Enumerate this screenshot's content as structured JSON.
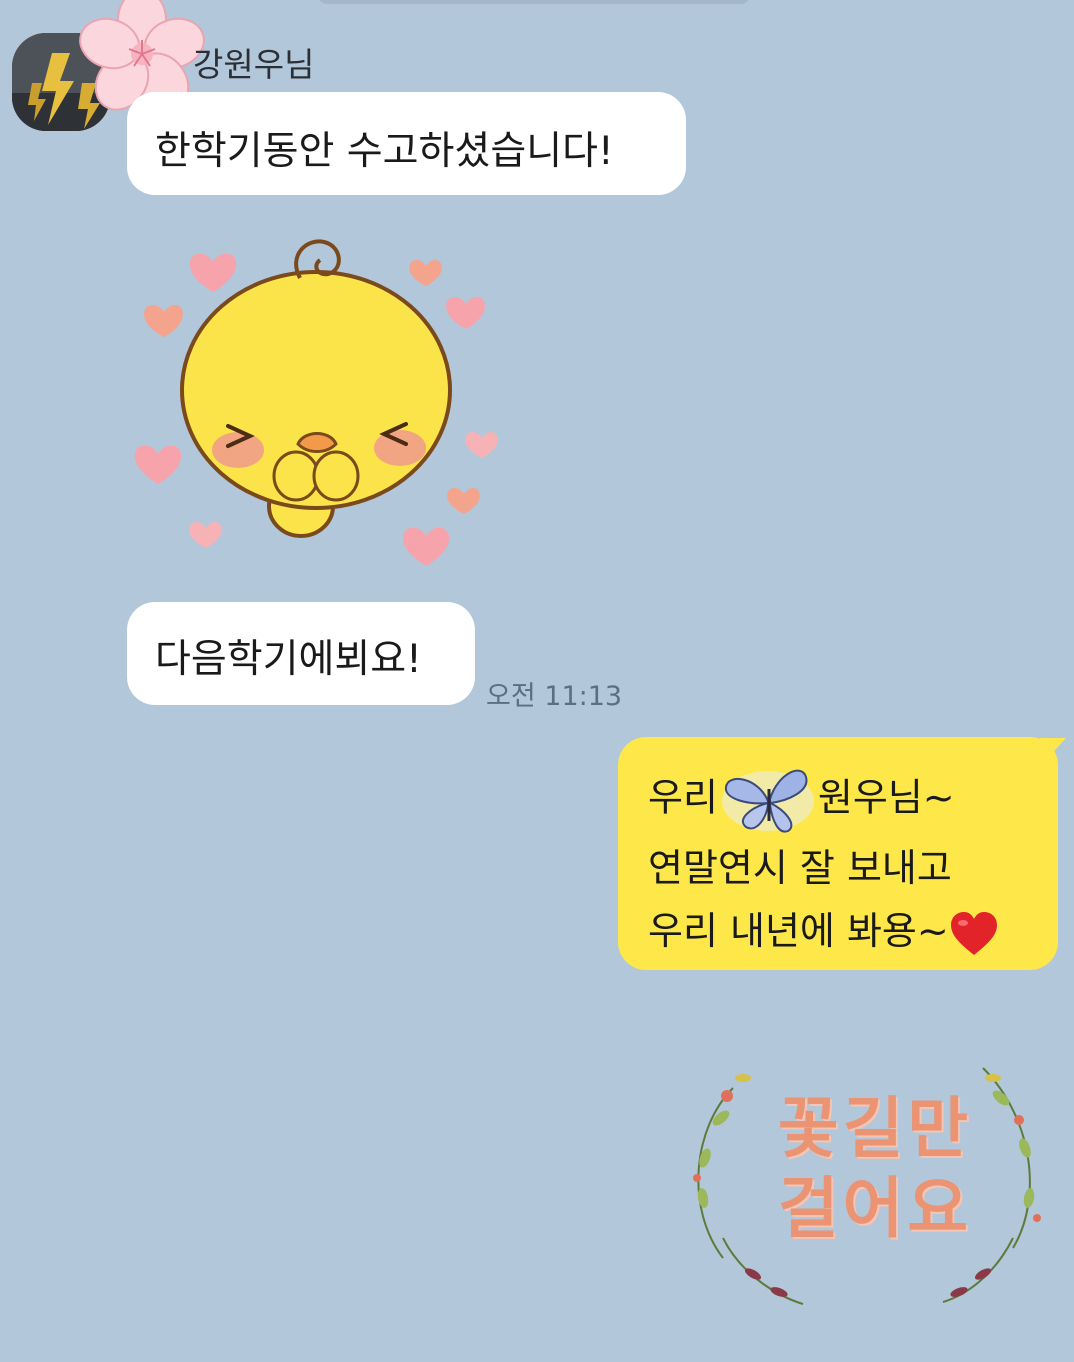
{
  "chat": {
    "sender_name": "강원우님",
    "messages": [
      {
        "text": "한학기동안 수고하셨습니다!"
      },
      {
        "sticker": "chick-heart-sticker"
      },
      {
        "text": "다음학기에뵈요!",
        "time": "오전 11:13"
      }
    ],
    "my_message": {
      "line1_a": "우리",
      "line1_b": "원우님~",
      "line2": "연말연시 잘 보내고",
      "line3": "우리 내년에 봐용~",
      "emoji": [
        "butterfly",
        "red-heart"
      ]
    },
    "my_sticker": {
      "line1": "꽃길만",
      "line2": "걸어요"
    }
  },
  "colors": {
    "background": "#b2c7da",
    "incoming_bubble": "#ffffff",
    "outgoing_bubble": "#fee849"
  }
}
